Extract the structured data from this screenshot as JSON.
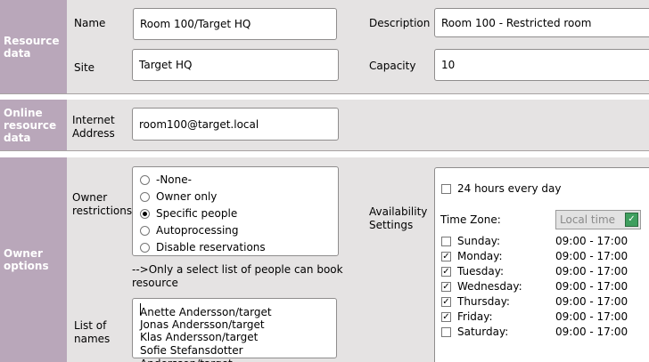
{
  "resource_data": {
    "section_label": "Resource data",
    "name_label": "Name",
    "name_value": "Room 100/Target HQ",
    "description_label": "Description",
    "description_value": "Room 100 - Restricted room",
    "site_label": "Site",
    "site_value": "Target HQ",
    "capacity_label": "Capacity",
    "capacity_value": "10"
  },
  "online_resource": {
    "section_label": "Online resource data",
    "internet_address_label": "Internet Address",
    "internet_address_value": "room100@target.local"
  },
  "owner_options": {
    "section_label": "Owner options",
    "owner_restrictions_label": "Owner restrictions",
    "options": [
      {
        "label": "-None-",
        "selected": false
      },
      {
        "label": "Owner only",
        "selected": false
      },
      {
        "label": "Specific people",
        "selected": true
      },
      {
        "label": "Autoprocessing",
        "selected": false
      },
      {
        "label": "Disable reservations",
        "selected": false
      }
    ],
    "note": "-->Only a select list of people can book resource",
    "list_of_names_label": "List of names",
    "names": [
      "Anette Andersson/target",
      "Jonas Andersson/target",
      "Klas Andersson/target",
      "Sofie Stefansdotter Andersson/target"
    ]
  },
  "availability": {
    "label": "Availability Settings",
    "all_day_label": "24 hours every day",
    "all_day_checked": false,
    "time_zone_label": "Time Zone:",
    "time_zone_value": "Local time",
    "days": [
      {
        "day": "Sunday:",
        "checked": false,
        "hours": "09:00 - 17:00"
      },
      {
        "day": "Monday:",
        "checked": true,
        "hours": "09:00 - 17:00"
      },
      {
        "day": "Tuesday:",
        "checked": true,
        "hours": "09:00 - 17:00"
      },
      {
        "day": "Wednesday:",
        "checked": true,
        "hours": "09:00 - 17:00"
      },
      {
        "day": "Thursday:",
        "checked": true,
        "hours": "09:00 - 17:00"
      },
      {
        "day": "Friday:",
        "checked": true,
        "hours": "09:00 - 17:00"
      },
      {
        "day": "Saturday:",
        "checked": false,
        "hours": "09:00 - 17:00"
      }
    ]
  },
  "colors": {
    "sidebar": "#b9a7ba",
    "panel": "#e5e3e3"
  }
}
